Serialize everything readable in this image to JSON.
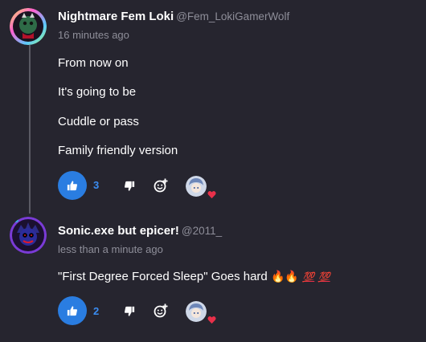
{
  "posts": [
    {
      "author": "Nightmare Fem Loki",
      "handle": "@Fem_LokiGamerWolf",
      "time": "16 minutes ago",
      "lines": [
        "From now on",
        "It's going to be",
        "Cuddle or pass",
        "Family friendly version"
      ],
      "likes": "3"
    },
    {
      "author": "Sonic.exe but epicer!",
      "handle": "@2011_",
      "time": "less than a minute ago",
      "text": "\"First Degree Forced Sleep\" Goes hard",
      "emojis": {
        "fire": "🔥",
        "hundred": "💯"
      },
      "likes": "2"
    }
  ],
  "icons": {
    "like": "thumbs-up-icon",
    "dislike": "thumbs-down-icon",
    "react": "add-reaction-icon",
    "reaction": "heart-icon"
  },
  "colors": {
    "background": "#26252f",
    "accent": "#2a7de1",
    "count": "#3b8df2",
    "muted": "#8e8e99",
    "heart": "#e8304a"
  }
}
